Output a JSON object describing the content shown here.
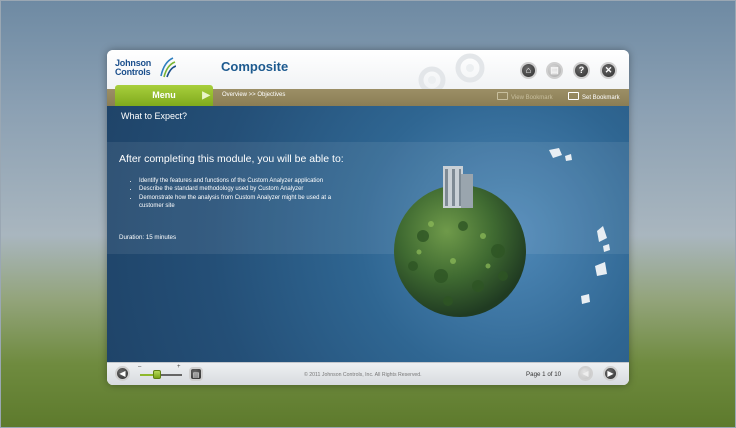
{
  "header": {
    "logo_text": "Johnson Controls",
    "title": "Composite",
    "buttons": [
      {
        "name": "home-icon",
        "glyph": "⌂",
        "disabled": false
      },
      {
        "name": "document-icon",
        "glyph": "▤",
        "disabled": true
      },
      {
        "name": "help-icon",
        "glyph": "?",
        "disabled": false
      },
      {
        "name": "close-icon",
        "glyph": "✕",
        "disabled": false
      }
    ]
  },
  "nav": {
    "menu_label": "Menu",
    "breadcrumb": "Overview >> Objectives",
    "view_bookmark": "View Bookmark",
    "set_bookmark": "Set Bookmark"
  },
  "content": {
    "section_title": "What to Expect?",
    "lead": "After completing this module, you will be able to:",
    "bullets": [
      "Identify the features and functions of the Custom Analyzer application",
      "Describe the standard methodology used by Custom Analyzer",
      "Demonstrate how the analysis from Custom Analyzer might be used at a customer site"
    ],
    "duration": "Duration: 15 minutes"
  },
  "footer": {
    "volume_minus": "–",
    "volume_plus": "+",
    "volume_level": 0.45,
    "copyright": "© 2011 Johnson Controls, Inc. All Rights Reserved.",
    "page_indicator": "Page 1 of 10"
  },
  "colors": {
    "accent_green": "#8fb82d",
    "title_blue": "#1d5a8f",
    "content_blue": "#2a5c86",
    "nav_tan": "#8a7d55"
  }
}
